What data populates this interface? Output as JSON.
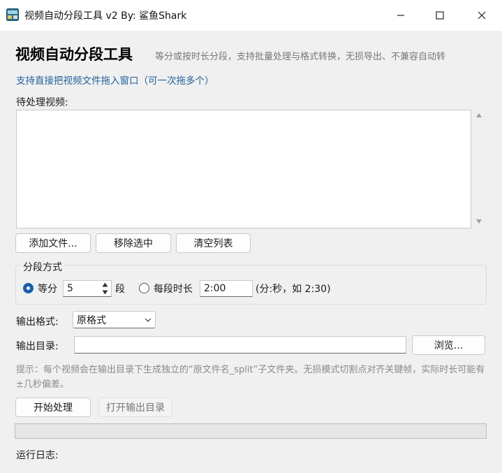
{
  "window": {
    "title": "视频自动分段工具 v2  By: 鲨鱼Shark",
    "minimize_icon": "minimize-icon",
    "maximize_icon": "maximize-icon",
    "close_icon": "close-icon"
  },
  "header": {
    "title": "视频自动分段工具",
    "subtitle": "等分或按时长分段，支持批量处理与格式转换，无损导出、不兼容自动转",
    "drag_hint": "支持直接把视频文件拖入窗口（可一次拖多个）"
  },
  "queue": {
    "label": "待处理视频:",
    "items": []
  },
  "buttons": {
    "add": "添加文件...",
    "remove": "移除选中",
    "clear": "清空列表",
    "browse": "浏览...",
    "start": "开始处理",
    "open_output": "打开输出目录"
  },
  "split": {
    "group_label": "分段方式",
    "equal_label": "等分",
    "equal_value": "5",
    "equal_unit": "段",
    "duration_label": "每段时长",
    "duration_value": "2:00",
    "duration_hint": "(分:秒，如 2:30)"
  },
  "output": {
    "format_label": "输出格式:",
    "format_value": "原格式",
    "dir_label": "输出目录:",
    "dir_value": ""
  },
  "note": "提示：每个视频会在输出目录下生成独立的“原文件名_split”子文件夹。无损模式切割点对齐关键帧，实际时长可能有 ±几秒偏差。",
  "progress": 0,
  "log": {
    "label": "运行日志:"
  },
  "colors": {
    "accent": "#1b5fa8",
    "link": "#1f5f9a"
  }
}
